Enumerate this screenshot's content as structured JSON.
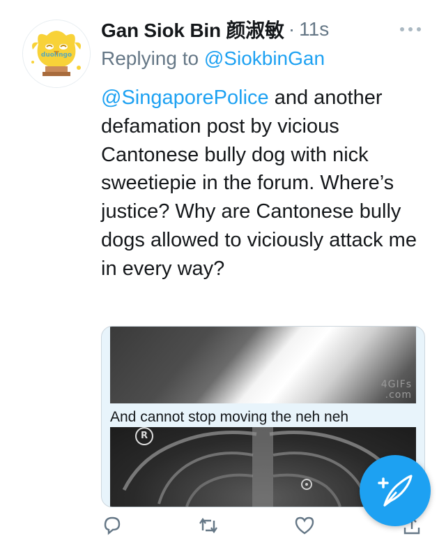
{
  "tweet": {
    "author": {
      "display_name": "Gan Siok Bin 颜淑敏",
      "avatar_text": "duolingo"
    },
    "separator": "·",
    "timestamp": "11s",
    "reply_prefix": "Replying to",
    "reply_to": "@SiokbinGan",
    "text_mention": "@SingaporePolice",
    "text_body": " and another defamation post by vicious Cantonese bully dog with nick sweetiepie in the forum. Where’s justice? Why are Cantonese bully dogs allowed to viciously attack me in every way?",
    "media": {
      "watermark_line1": "4GIFs",
      "watermark_line2": ".com",
      "caption": "And cannot stop moving the neh neh",
      "marker": "R"
    }
  },
  "colors": {
    "accent": "#1da1f2",
    "text": "#14171a",
    "secondary": "#657786"
  },
  "icons": {
    "more": "more-horizontal-icon",
    "reply": "reply-icon",
    "retweet": "retweet-icon",
    "like": "heart-icon",
    "share": "share-icon",
    "compose": "compose-tweet-icon"
  }
}
